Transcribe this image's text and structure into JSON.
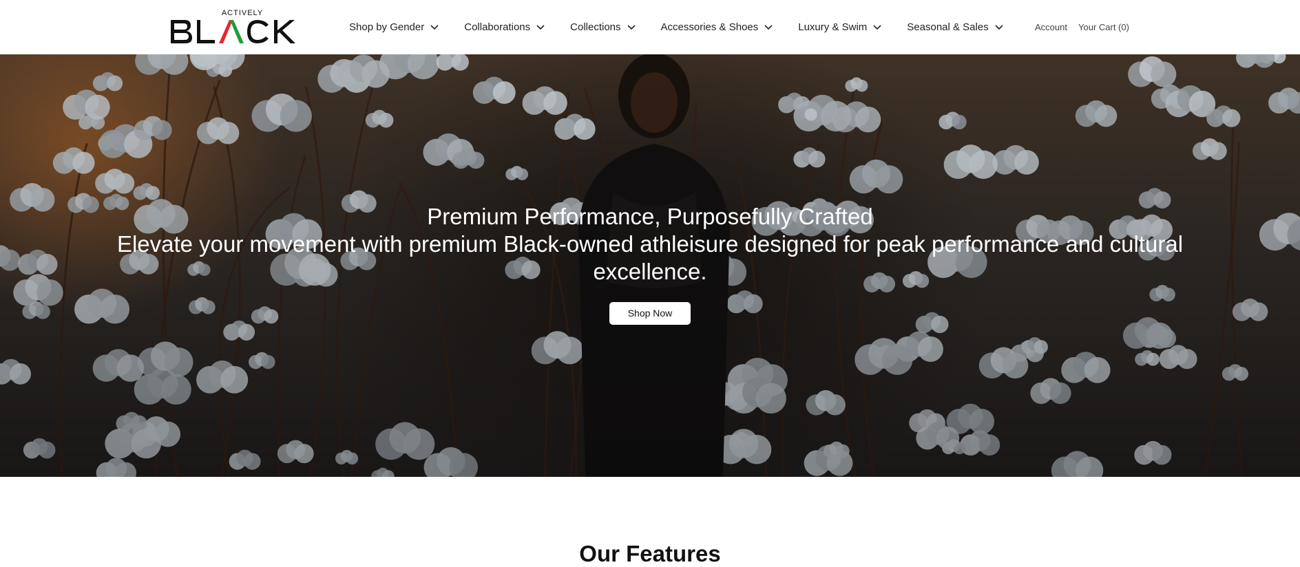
{
  "header": {
    "logo": {
      "small_text": "ACTIVELY",
      "big_text": "BLACK"
    },
    "nav": [
      {
        "label": "Shop by Gender"
      },
      {
        "label": "Collaborations"
      },
      {
        "label": "Collections"
      },
      {
        "label": "Accessories & Shoes"
      },
      {
        "label": "Luxury & Swim"
      },
      {
        "label": "Seasonal & Sales"
      }
    ],
    "account_label": "Account",
    "cart_label": "Your Cart (0)"
  },
  "hero": {
    "title": "Premium Performance, Purposefully Crafted",
    "subtitle": "Elevate your movement with premium Black-owned athleisure designed for peak performance and cultural excellence.",
    "cta_label": "Shop Now"
  },
  "features": {
    "title": "Our Features"
  },
  "colors": {
    "logo_red": "#e8262c",
    "logo_green": "#1f9d3a",
    "text_dark": "#222222",
    "hero_text": "#ffffff"
  },
  "icons": {
    "nav_dropdown": "chevron-down-icon"
  }
}
